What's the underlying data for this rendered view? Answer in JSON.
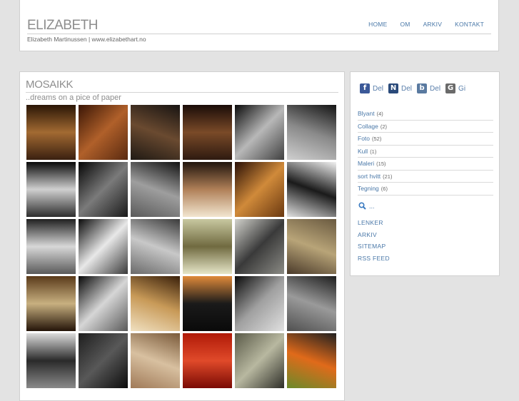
{
  "header": {
    "title": "ELIZABETH",
    "subtitle": "Elizabeth Martinussen | www.elizabethart.no",
    "nav": [
      "HOME",
      "OM",
      "ARKIV",
      "KONTAKT"
    ]
  },
  "main": {
    "title": "MOSAIKK",
    "subtitle": "..dreams on a pice of paper",
    "thumbnails": [
      {
        "colors": [
          "#2a1606",
          "#a26a32",
          "#3a2010"
        ]
      },
      {
        "colors": [
          "#3a1606",
          "#b0602a",
          "#5a2a10"
        ]
      },
      {
        "colors": [
          "#181412",
          "#6a4a30",
          "#201a14"
        ]
      },
      {
        "colors": [
          "#1a0c08",
          "#7a4a28",
          "#2e1a10"
        ]
      },
      {
        "colors": [
          "#0a0a0a",
          "#b8b8b8",
          "#404040"
        ]
      },
      {
        "colors": [
          "#141414",
          "#8a8a8a",
          "#cfcfcf"
        ]
      },
      {
        "colors": [
          "#090909",
          "#d0d0d0",
          "#2e2e2e"
        ]
      },
      {
        "colors": [
          "#050505",
          "#7a7a7a",
          "#1a1a1a"
        ]
      },
      {
        "colors": [
          "#121212",
          "#9e9e9e",
          "#5a5a5a"
        ]
      },
      {
        "colors": [
          "#20140c",
          "#b08058",
          "#f2e6d0"
        ]
      },
      {
        "colors": [
          "#2a1006",
          "#d08a3a",
          "#6a3810"
        ]
      },
      {
        "colors": [
          "#f2f2f2",
          "#1a1a1a",
          "#e0e0e0"
        ]
      },
      {
        "colors": [
          "#202020",
          "#d8d8d8",
          "#5a5a5a"
        ]
      },
      {
        "colors": [
          "#0a0a0a",
          "#e8e8e8",
          "#3a3a3a"
        ]
      },
      {
        "colors": [
          "#3a3a3a",
          "#c8c8c8",
          "#6a6a6a"
        ]
      },
      {
        "colors": [
          "#c8c8a0",
          "#706a40",
          "#e6e6c8"
        ]
      },
      {
        "colors": [
          "#d2d2cc",
          "#3a3a3a",
          "#8a8a84"
        ]
      },
      {
        "colors": [
          "#6a5a40",
          "#b8a478",
          "#4a3a2a"
        ]
      },
      {
        "colors": [
          "#5a3a1a",
          "#c8b080",
          "#241408"
        ]
      },
      {
        "colors": [
          "#080808",
          "#d6d6d6",
          "#5a5a5a"
        ]
      },
      {
        "colors": [
          "#3a200a",
          "#c89a58",
          "#f0e0c0"
        ]
      },
      {
        "colors": [
          "#e08a3a",
          "#1a1a1a",
          "#0a0a0a"
        ]
      },
      {
        "colors": [
          "#0a0a0a",
          "#a0a0a0",
          "#e0e0e0"
        ]
      },
      {
        "colors": [
          "#1e1e1e",
          "#9a9a9a",
          "#505050"
        ]
      },
      {
        "colors": [
          "#dcdcdc",
          "#2a2a2a",
          "#8a8a8a"
        ]
      },
      {
        "colors": [
          "#1e1e1e",
          "#585858",
          "#0c0c0c"
        ]
      },
      {
        "colors": [
          "#7a5a3a",
          "#d8c0a0",
          "#a07a58"
        ]
      },
      {
        "colors": [
          "#b01a08",
          "#e04a2a",
          "#7a0a04"
        ]
      },
      {
        "colors": [
          "#5a5a48",
          "#b8b8a0",
          "#2e2e28"
        ]
      },
      {
        "colors": [
          "#202020",
          "#e06a1a",
          "#6a8a2a"
        ]
      }
    ]
  },
  "sidebar": {
    "share": [
      {
        "icon": "facebook-icon",
        "glyph": "f",
        "color": "#3b5998",
        "label": "Del"
      },
      {
        "icon": "nettby-icon",
        "glyph": "N",
        "color": "#2a4a7a",
        "label": "Del"
      },
      {
        "icon": "blink-icon",
        "glyph": "b",
        "color": "#5a7aa0",
        "label": "Del"
      },
      {
        "icon": "gi-icon",
        "glyph": "G",
        "color": "#6a6a6a",
        "label": "Gi"
      }
    ],
    "categories": [
      {
        "name": "Blyant",
        "count": "(4)"
      },
      {
        "name": "Collage",
        "count": "(2)"
      },
      {
        "name": "Foto",
        "count": "(52)"
      },
      {
        "name": "Kull",
        "count": "(1)"
      },
      {
        "name": "Maleri",
        "count": "(15)"
      },
      {
        "name": "sort hvitt",
        "count": "(21)"
      },
      {
        "name": "Tegning",
        "count": "(6)"
      }
    ],
    "search_text": "...",
    "links": [
      "LENKER",
      "ARKIV",
      "SITEMAP",
      "RSS FEED"
    ]
  }
}
